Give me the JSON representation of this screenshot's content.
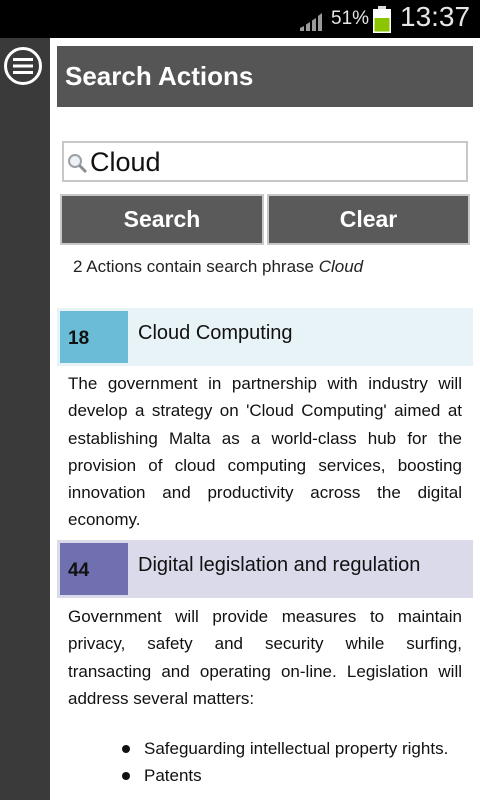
{
  "status_bar": {
    "battery_percent": "51%",
    "time": "13:37",
    "icons": [
      "signal-icon",
      "battery-icon"
    ]
  },
  "nav": {
    "menu_icon": "menu-icon"
  },
  "header": {
    "title": "Search Actions"
  },
  "search": {
    "value": "Cloud",
    "search_label": "Search",
    "clear_label": "Clear",
    "summary_prefix": "2 Actions contain search phrase ",
    "summary_phrase": "Cloud"
  },
  "results": [
    {
      "number": "18",
      "title": "Cloud Computing",
      "body": "The government in partnership with industry will develop a strategy on 'Cloud Computing' aimed at establishing Malta as a world-class hub for the provision of cloud computing services, boosting innovation and productivity across the digital economy."
    },
    {
      "number": "44",
      "title": "Digital legislation and regulation",
      "body": "Government will provide measures to maintain privacy, safety and security while surfing, transacting and operating on-line. Legislation will address several matters:",
      "bullets": [
        "Safeguarding intellectual property rights.",
        "Patents"
      ]
    }
  ],
  "colors": {
    "header_bg": "#555555",
    "rail_bg": "#3a3a3a",
    "result1_accent": "#6bbcd7",
    "result1_bg": "#e8f3f8",
    "result2_accent": "#7070b0",
    "result2_bg": "#dadaeb"
  }
}
